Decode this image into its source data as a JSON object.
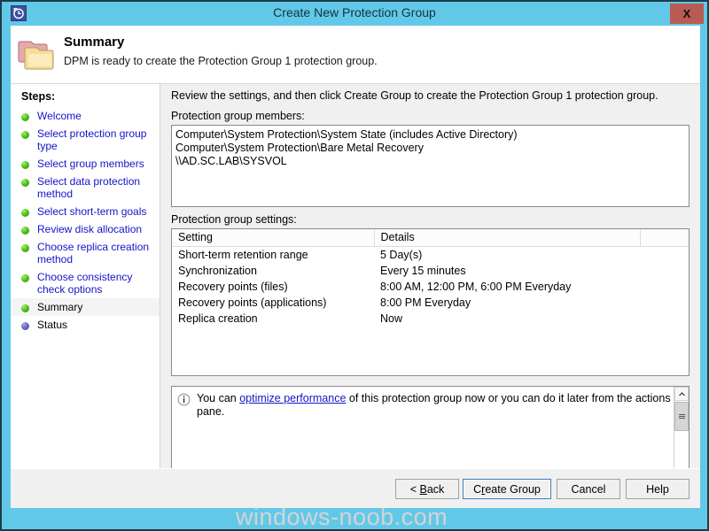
{
  "window": {
    "title": "Create New Protection Group",
    "icon": "clock-icon",
    "close_label": "X",
    "frame_color": "#62c8e8",
    "border_color": "#1d3c4a",
    "close_color": "#b85c53"
  },
  "header": {
    "icon": "folder-icon",
    "title": "Summary",
    "subtitle": "DPM is ready to create the Protection Group 1 protection group."
  },
  "sidebar": {
    "label": "Steps:",
    "items": [
      {
        "label": "Welcome",
        "state": "done"
      },
      {
        "label": "Select protection group type",
        "state": "done"
      },
      {
        "label": "Select group members",
        "state": "done"
      },
      {
        "label": "Select data protection method",
        "state": "done"
      },
      {
        "label": "Select short-term goals",
        "state": "done"
      },
      {
        "label": "Review disk allocation",
        "state": "done"
      },
      {
        "label": "Choose replica creation method",
        "state": "done"
      },
      {
        "label": "Choose consistency check options",
        "state": "done"
      },
      {
        "label": "Summary",
        "state": "current"
      },
      {
        "label": "Status",
        "state": "pending"
      }
    ]
  },
  "content": {
    "intro_text": "Review the settings, and then click Create Group to create the Protection Group 1 protection group.",
    "members": {
      "label": "Protection group members:",
      "lines": [
        "Computer\\System Protection\\System State (includes Active Directory)",
        "Computer\\System Protection\\Bare Metal Recovery",
        "\\\\AD.SC.LAB\\SYSVOL"
      ]
    },
    "settings": {
      "label": "Protection group settings:",
      "columns": [
        "Setting",
        "Details",
        ""
      ],
      "rows": [
        {
          "setting": "Short-term retention range",
          "details": "5 Day(s)"
        },
        {
          "setting": "Synchronization",
          "details": "Every 15 minutes"
        },
        {
          "setting": "Recovery points (files)",
          "details": "8:00 AM, 12:00 PM, 6:00 PM Everyday"
        },
        {
          "setting": "Recovery points (applications)",
          "details": "8:00 PM Everyday"
        },
        {
          "setting": "Replica creation",
          "details": "Now"
        }
      ]
    },
    "info": {
      "icon": "info-icon",
      "text_before": "You can ",
      "link_text": "optimize performance",
      "text_after": " of this protection group now or you can do it later from the actions pane.",
      "link_color": "#1414c8"
    }
  },
  "buttons": {
    "back": {
      "prefix": "< ",
      "accel": "B",
      "rest": "ack"
    },
    "create": {
      "prefix": "C",
      "accel": "r",
      "rest": "eate Group"
    },
    "cancel": "Cancel",
    "help": "Help"
  },
  "watermark": "windows-noob.com"
}
